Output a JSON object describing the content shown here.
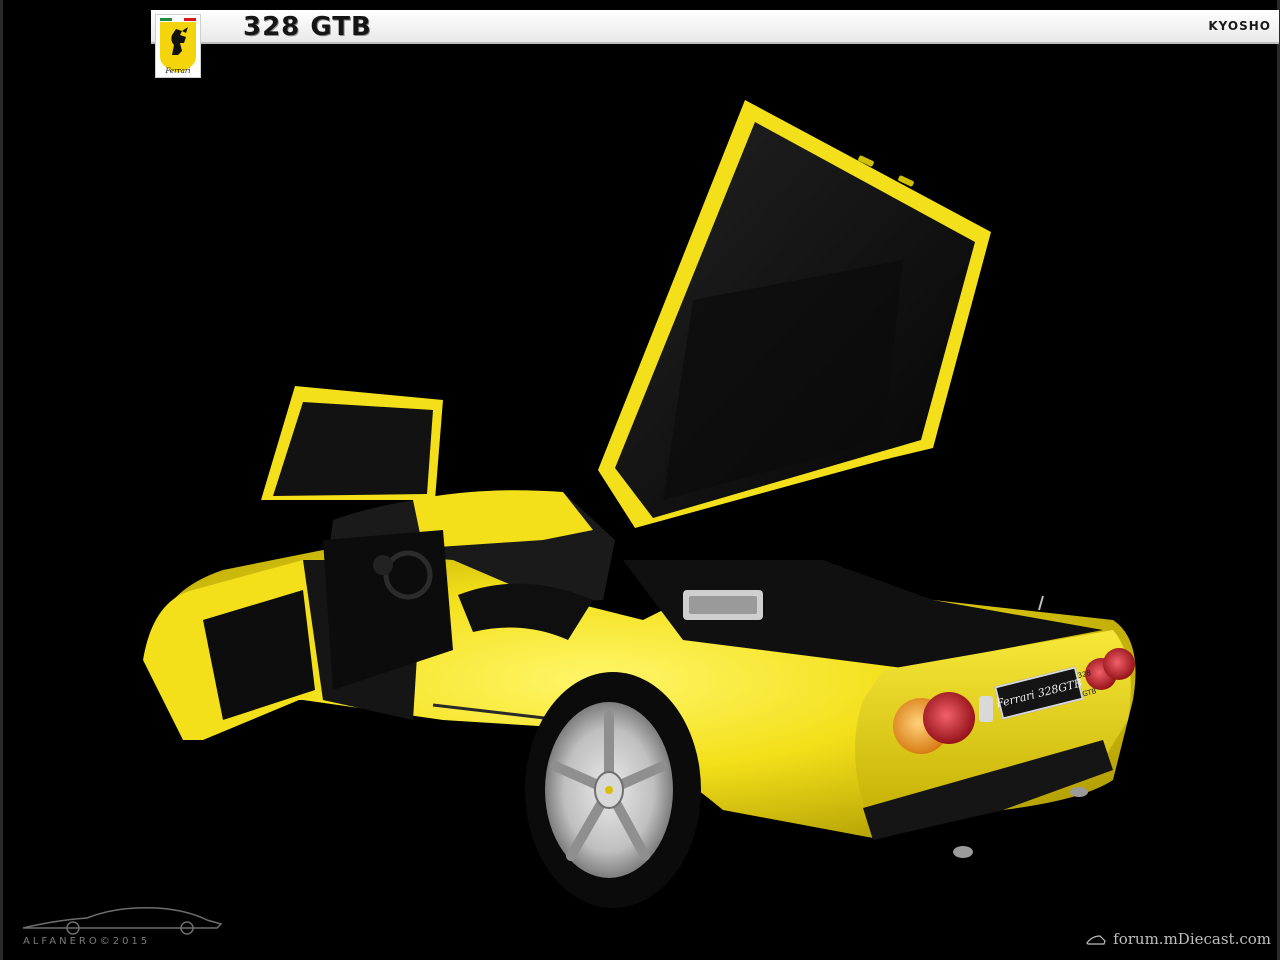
{
  "header": {
    "title": "328 GTB",
    "brand": "KYOSHO"
  },
  "badge": {
    "icon": "ferrari-prancing-horse-icon",
    "text": "Ferrari"
  },
  "car": {
    "plate_text": "Ferrari 328GTB",
    "side_badge": "328 GTB",
    "colors": {
      "body": "#f3e01a",
      "body_shadow": "#b9a400",
      "interior": "#101010",
      "tail_amber": "#e68a12",
      "tail_red": "#b8141a"
    }
  },
  "watermarks": {
    "left_text": "ALFANERO©2015",
    "right_text": "forum.mDiecast.com"
  }
}
